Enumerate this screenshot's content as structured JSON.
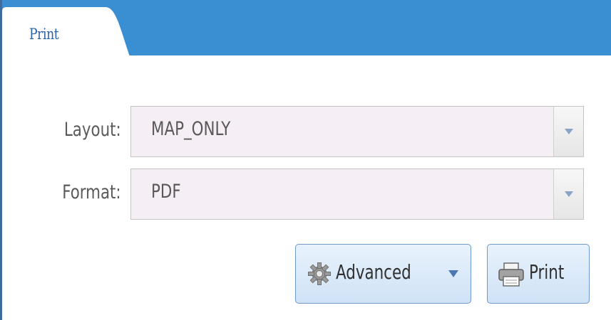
{
  "panel": {
    "tab_title": "Print"
  },
  "form": {
    "layout": {
      "label": "Layout:",
      "value": "MAP_ONLY"
    },
    "format": {
      "label": "Format:",
      "value": "PDF"
    }
  },
  "buttons": {
    "advanced_label": "Advanced",
    "print_label": "Print"
  },
  "icons": {
    "advanced": "gear-icon",
    "print": "printer-icon",
    "dropdown": "chevron-down-icon"
  },
  "colors": {
    "header_blue": "#3a8fd3",
    "field_background": "#f5eff5",
    "button_border": "#6e99c8"
  }
}
